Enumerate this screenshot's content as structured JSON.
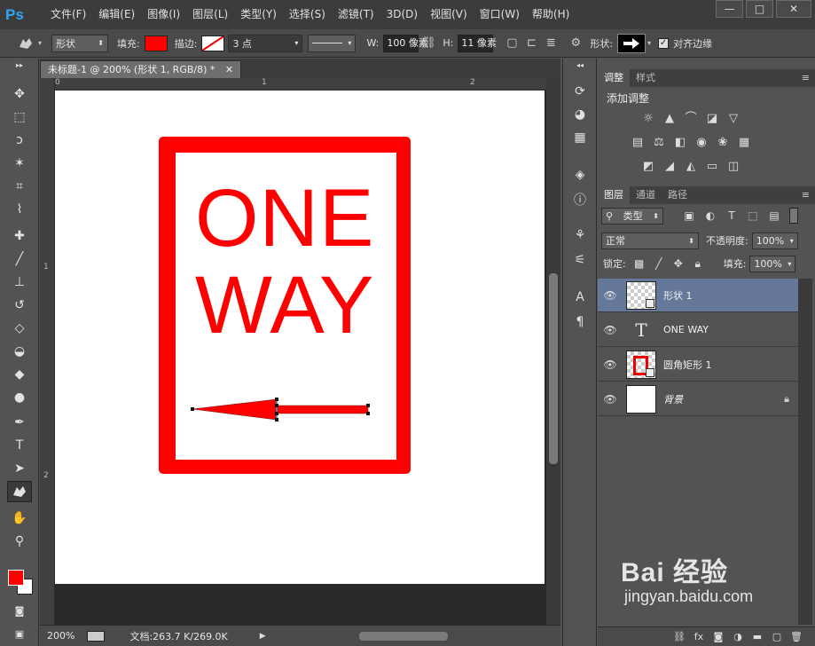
{
  "app": {
    "logo": "Ps"
  },
  "menu": [
    "文件(F)",
    "编辑(E)",
    "图像(I)",
    "图层(L)",
    "类型(Y)",
    "选择(S)",
    "滤镜(T)",
    "3D(D)",
    "视图(V)",
    "窗口(W)",
    "帮助(H)"
  ],
  "window_controls": {
    "minimize": "—",
    "maximize": "□",
    "close": "✕"
  },
  "options": {
    "tool_mode": "形状",
    "fill_label": "填充:",
    "fill_color": "#ff0000",
    "stroke_label": "描边:",
    "stroke_width": "3 点",
    "w_label": "W:",
    "w_value": "100 像素",
    "h_label": "H:",
    "h_value": "11 像素",
    "shape_label": "形状:",
    "align_edges_label": "对齐边缘",
    "align_edges_checked": true
  },
  "document": {
    "tab_title": "未标题-1 @ 200% (形状 1, RGB/8) *",
    "ruler_top": [
      "0",
      "1",
      "2"
    ],
    "ruler_left": [
      "1",
      "2"
    ],
    "sign_line_1": "ONE",
    "sign_line_2": "WAY",
    "sign_color": "#ff0000"
  },
  "status": {
    "zoom": "200%",
    "doc_info": "文档:263.7 K/269.0K"
  },
  "panels": {
    "top_tabs": [
      "调整",
      "样式"
    ],
    "adjust_title": "添加调整",
    "layer_tabs": [
      "图层",
      "通道",
      "路径"
    ],
    "filter_kind": "类型",
    "blend_mode": "正常",
    "opacity_label": "不透明度:",
    "opacity": "100%",
    "lock_label": "锁定:",
    "fill_label": "填充:",
    "fill": "100%",
    "layers": [
      {
        "name": "形状 1",
        "kind": "shape",
        "selected": true
      },
      {
        "name": "ONE WAY",
        "kind": "text",
        "selected": false
      },
      {
        "name": "圆角矩形 1",
        "kind": "shape-rect",
        "selected": false
      },
      {
        "name": "背景",
        "kind": "background",
        "selected": false,
        "locked": true
      }
    ]
  },
  "watermark": {
    "brand": "Bai 经验",
    "url": "jingyan.baidu.com"
  }
}
